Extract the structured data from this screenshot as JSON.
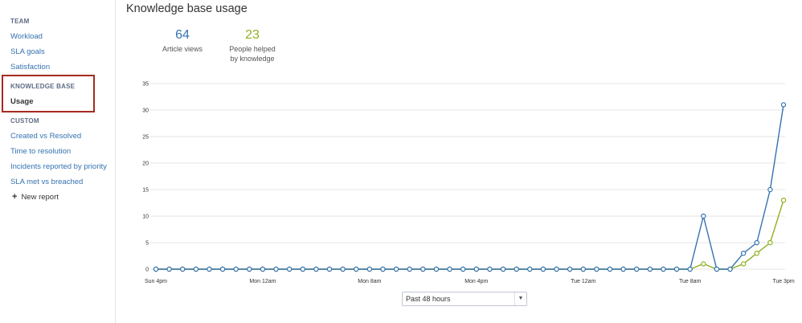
{
  "sidebar": {
    "team_heading": "TEAM",
    "team_items": [
      "Workload",
      "SLA goals",
      "Satisfaction"
    ],
    "kb_heading": "KNOWLEDGE BASE",
    "kb_items": [
      "Usage"
    ],
    "custom_heading": "CUSTOM",
    "custom_items": [
      "Created vs Resolved",
      "Time to resolution",
      "Incidents reported by priority",
      "SLA met vs breached"
    ],
    "new_report_label": "New report"
  },
  "page": {
    "title": "Knowledge base usage"
  },
  "stats": {
    "article_views": {
      "value": "64",
      "label_line1": "Article views",
      "label_line2": ""
    },
    "people_helped": {
      "value": "23",
      "label_line1": "People helped",
      "label_line2": "by knowledge"
    }
  },
  "colors": {
    "series1": "#3572b0",
    "series2": "#8eb021",
    "grid": "#e5e5e5",
    "highlight": "#a52a1f"
  },
  "range_select": {
    "value": "Past 48 hours",
    "icon": "chevron-down-icon"
  },
  "chart_data": {
    "type": "line",
    "ylim": [
      0,
      35
    ],
    "yticks": [
      0,
      5,
      10,
      15,
      20,
      25,
      30,
      35
    ],
    "xtick_labels": [
      "Sun 4pm",
      "Mon 12am",
      "Mon 8am",
      "Mon 4pm",
      "Tue 12am",
      "Tue 8am",
      "Tue 3pm"
    ],
    "xtick_indices": [
      0,
      8,
      16,
      24,
      32,
      40,
      47
    ],
    "grid": true,
    "series": [
      {
        "name": "Article views",
        "color": "#3572b0",
        "values": [
          0,
          0,
          0,
          0,
          0,
          0,
          0,
          0,
          0,
          0,
          0,
          0,
          0,
          0,
          0,
          0,
          0,
          0,
          0,
          0,
          0,
          0,
          0,
          0,
          0,
          0,
          0,
          0,
          0,
          0,
          0,
          0,
          0,
          0,
          0,
          0,
          0,
          0,
          0,
          0,
          0,
          10,
          0,
          0,
          3,
          5,
          15,
          31
        ]
      },
      {
        "name": "People helped by knowledge",
        "color": "#8eb021",
        "values": [
          0,
          0,
          0,
          0,
          0,
          0,
          0,
          0,
          0,
          0,
          0,
          0,
          0,
          0,
          0,
          0,
          0,
          0,
          0,
          0,
          0,
          0,
          0,
          0,
          0,
          0,
          0,
          0,
          0,
          0,
          0,
          0,
          0,
          0,
          0,
          0,
          0,
          0,
          0,
          0,
          0,
          1,
          0,
          0,
          1,
          3,
          5,
          13
        ]
      }
    ]
  }
}
